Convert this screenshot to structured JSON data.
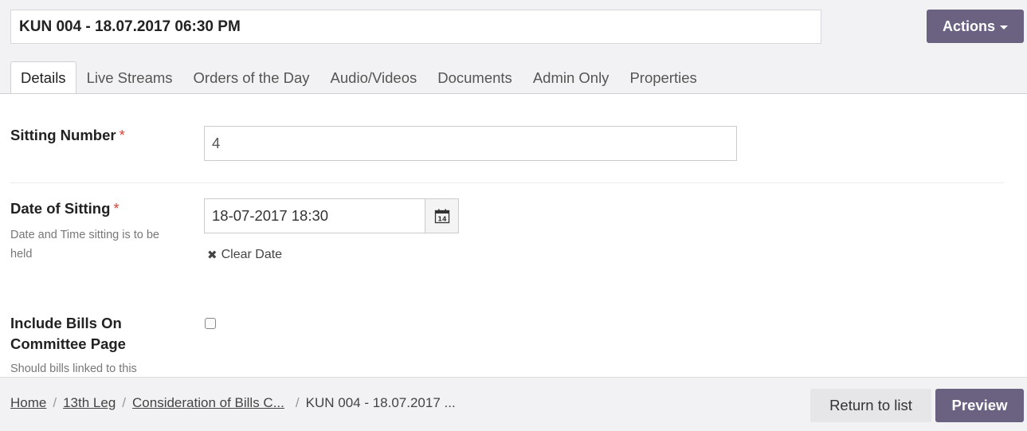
{
  "header": {
    "title_value": "KUN 004 - 18.07.2017 06:30 PM",
    "actions_label": "Actions"
  },
  "tabs": [
    {
      "label": "Details",
      "active": true
    },
    {
      "label": "Live Streams"
    },
    {
      "label": "Orders of the Day"
    },
    {
      "label": "Audio/Videos"
    },
    {
      "label": "Documents"
    },
    {
      "label": "Admin Only"
    },
    {
      "label": "Properties"
    }
  ],
  "form": {
    "sitting_number": {
      "label": "Sitting Number",
      "required_mark": "*",
      "value": "4"
    },
    "date_of_sitting": {
      "label": "Date of Sitting",
      "required_mark": "*",
      "help_line1": "Date and Time sitting is to be",
      "help_line2": "held",
      "value": "18-07-2017 18:30",
      "calendar_day": "14",
      "clear_label": "Clear Date"
    },
    "include_bills": {
      "label_line1": "Include Bills On",
      "label_line2": "Committee Page",
      "help": "Should bills linked to this",
      "checked": false
    }
  },
  "breadcrumb": {
    "items": [
      "Home",
      "13th Leg",
      "Consideration of Bills C..."
    ],
    "current": "KUN 004 - 18.07.2017 ..."
  },
  "footer": {
    "return_label": "Return to list",
    "preview_label": "Preview"
  },
  "colors": {
    "accent": "#6b6180",
    "required": "#d9443a"
  }
}
